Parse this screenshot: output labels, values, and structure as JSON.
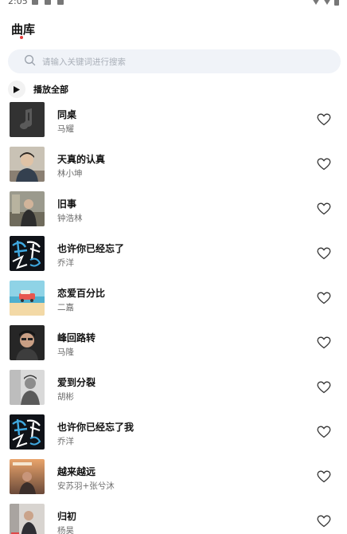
{
  "status_bar": {
    "time": "2:05"
  },
  "header": {
    "title": "曲库"
  },
  "search": {
    "placeholder": "请输入关键词进行搜索",
    "icon": "search-icon"
  },
  "play_all": {
    "label": "播放全部",
    "icon": "play-icon"
  },
  "songs": [
    {
      "title": "同桌",
      "artist": "马耀",
      "cover": "dark-music-note"
    },
    {
      "title": "天真的认真",
      "artist": "林小坤",
      "cover": "portrait"
    },
    {
      "title": "旧事",
      "artist": "钟浩林",
      "cover": "portrait-outdoor"
    },
    {
      "title": "也许你已经忘了",
      "artist": "乔洋",
      "cover": "graphic-calligraphy"
    },
    {
      "title": "恋爱百分比",
      "artist": "二嘉",
      "cover": "beach-illustration"
    },
    {
      "title": "峰回路转",
      "artist": "马隆",
      "cover": "portrait-dark"
    },
    {
      "title": "爱到分裂",
      "artist": "胡彬",
      "cover": "grayscale-portrait"
    },
    {
      "title": "也许你已经忘了我",
      "artist": "乔洋",
      "cover": "graphic-calligraphy"
    },
    {
      "title": "越来越远",
      "artist": "安苏羽+张兮沐",
      "cover": "sunset-portrait"
    },
    {
      "title": "归初",
      "artist": "杨昊",
      "cover": "portrait-light"
    }
  ],
  "colors": {
    "accent_dot": "#e33b3b",
    "search_bg": "#f0f3f8"
  }
}
